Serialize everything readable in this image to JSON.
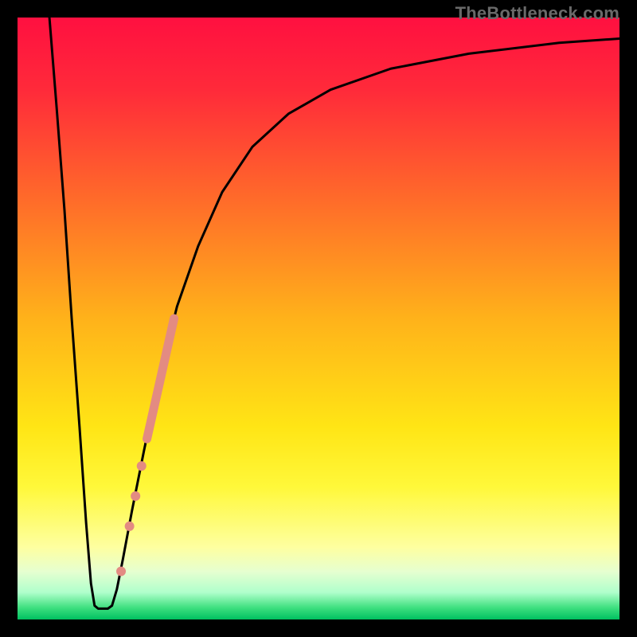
{
  "watermark": "TheBottleneck.com",
  "chart_data": {
    "type": "line",
    "title": "",
    "xlabel": "",
    "ylabel": "",
    "xlim": [
      0,
      100
    ],
    "ylim": [
      0,
      100
    ],
    "grid": false,
    "legend": false,
    "gradient_stops": [
      {
        "offset": 0.0,
        "color": "#ff1040"
      },
      {
        "offset": 0.12,
        "color": "#ff2a3a"
      },
      {
        "offset": 0.3,
        "color": "#ff6a2a"
      },
      {
        "offset": 0.5,
        "color": "#ffb21a"
      },
      {
        "offset": 0.68,
        "color": "#ffe515"
      },
      {
        "offset": 0.78,
        "color": "#fff83a"
      },
      {
        "offset": 0.88,
        "color": "#feffa0"
      },
      {
        "offset": 0.92,
        "color": "#e6ffd0"
      },
      {
        "offset": 0.955,
        "color": "#b0ffcc"
      },
      {
        "offset": 0.98,
        "color": "#40e080"
      },
      {
        "offset": 1.0,
        "color": "#00c060"
      }
    ],
    "series": [
      {
        "name": "curve",
        "stroke": "#000000",
        "points": [
          {
            "x": 5.3,
            "y": 100.0
          },
          {
            "x": 6.5,
            "y": 85.0
          },
          {
            "x": 7.8,
            "y": 68.0
          },
          {
            "x": 9.0,
            "y": 50.0
          },
          {
            "x": 10.3,
            "y": 32.0
          },
          {
            "x": 11.4,
            "y": 16.0
          },
          {
            "x": 12.2,
            "y": 6.0
          },
          {
            "x": 12.8,
            "y": 2.3
          },
          {
            "x": 13.4,
            "y": 1.8
          },
          {
            "x": 14.2,
            "y": 1.8
          },
          {
            "x": 15.0,
            "y": 1.8
          },
          {
            "x": 15.7,
            "y": 2.3
          },
          {
            "x": 16.5,
            "y": 5.0
          },
          {
            "x": 17.5,
            "y": 10.0
          },
          {
            "x": 19.0,
            "y": 18.0
          },
          {
            "x": 21.0,
            "y": 28.0
          },
          {
            "x": 23.5,
            "y": 40.0
          },
          {
            "x": 26.5,
            "y": 52.0
          },
          {
            "x": 30.0,
            "y": 62.0
          },
          {
            "x": 34.0,
            "y": 71.0
          },
          {
            "x": 39.0,
            "y": 78.5
          },
          {
            "x": 45.0,
            "y": 84.0
          },
          {
            "x": 52.0,
            "y": 88.0
          },
          {
            "x": 62.0,
            "y": 91.5
          },
          {
            "x": 75.0,
            "y": 94.0
          },
          {
            "x": 90.0,
            "y": 95.8
          },
          {
            "x": 100.0,
            "y": 96.5
          }
        ]
      },
      {
        "name": "highlight-segment",
        "stroke": "#e38b82",
        "stroke_width": 11,
        "points": [
          {
            "x": 21.5,
            "y": 30.0
          },
          {
            "x": 26.0,
            "y": 50.0
          }
        ]
      }
    ],
    "markers": [
      {
        "name": "dot-1",
        "x": 17.2,
        "y": 8.0,
        "r": 6,
        "fill": "#e38b82"
      },
      {
        "name": "dot-2",
        "x": 18.6,
        "y": 15.5,
        "r": 6,
        "fill": "#e38b82"
      },
      {
        "name": "dot-3",
        "x": 19.6,
        "y": 20.5,
        "r": 6,
        "fill": "#e38b82"
      },
      {
        "name": "dot-4",
        "x": 20.6,
        "y": 25.5,
        "r": 6,
        "fill": "#e38b82"
      }
    ]
  }
}
